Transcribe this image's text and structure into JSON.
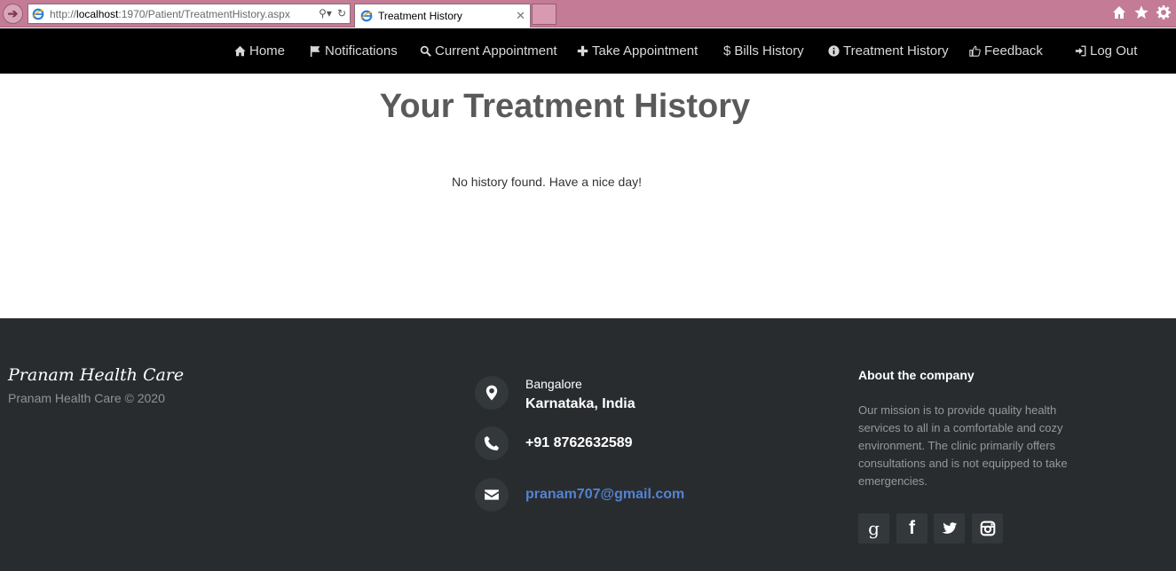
{
  "browser": {
    "url_prefix": "http://",
    "url_host": "localhost",
    "url_rest": ":1970/Patient/TreatmentHistory.aspx",
    "tab_title": "Treatment History"
  },
  "nav": {
    "items": [
      {
        "label": "Home",
        "icon": "home-icon"
      },
      {
        "label": "Notifications",
        "icon": "flag-icon"
      },
      {
        "label": "Current Appointment",
        "icon": "search-icon"
      },
      {
        "label": "Take Appointment",
        "icon": "plus-icon"
      },
      {
        "label": "Bills History",
        "icon": "dollar-icon"
      },
      {
        "label": "Treatment History",
        "icon": "info-icon"
      },
      {
        "label": "Feedback",
        "icon": "thumbs-up-icon"
      },
      {
        "label": "Log Out",
        "icon": "log-out-icon"
      }
    ]
  },
  "main": {
    "title": "Your Treatment History",
    "empty_message": "No history found. Have a nice day!"
  },
  "footer": {
    "brand": "Pranam Health Care",
    "copyright": "Pranam Health Care © 2020",
    "contact": {
      "city": "Bangalore",
      "state": "Karnataka, India",
      "phone": "+91 8762632589",
      "email": "pranam707@gmail.com"
    },
    "about": {
      "title": "About the company",
      "text": "Our mission is to provide quality health services to all in a comfortable and cozy environment. The clinic primarily offers consultations and is not equipped to take emergencies."
    },
    "social": [
      "google-icon",
      "facebook-icon",
      "twitter-icon",
      "instagram-icon"
    ]
  },
  "colors": {
    "navbar_bg": "#000000",
    "footer_bg": "#292c2f",
    "link_blue": "#5383d3",
    "chrome_pink": "#c37b96"
  }
}
